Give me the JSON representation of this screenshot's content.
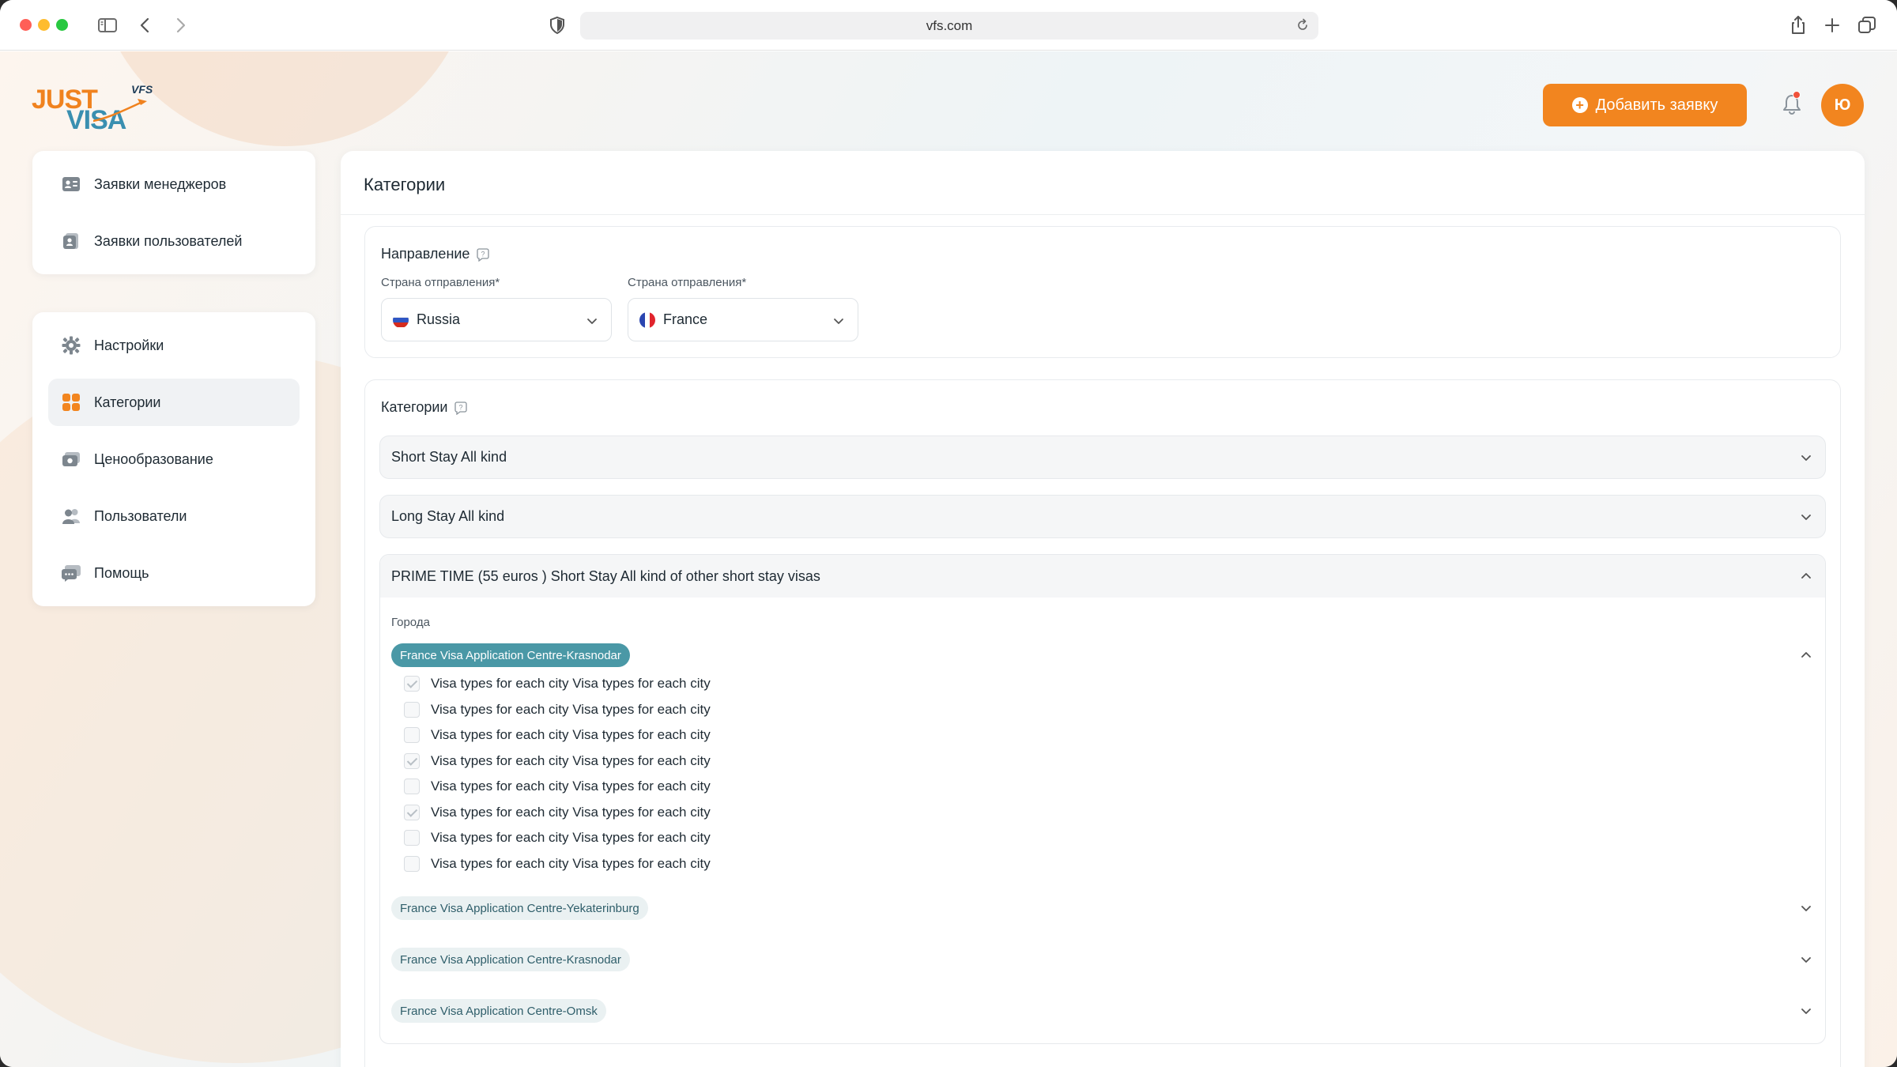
{
  "browser": {
    "url": "vfs.com"
  },
  "header": {
    "logo": {
      "just": "JUST",
      "visa": "VISA",
      "vfs": "VFS"
    },
    "add_button_label": "Добавить заявку",
    "avatar_initial": "Ю"
  },
  "sidebar": {
    "top_items": [
      {
        "label": "Заявки менеджеров",
        "icon": "id-card-icon"
      },
      {
        "label": "Заявки пользователей",
        "icon": "user-requests-icon"
      }
    ],
    "items": [
      {
        "label": "Настройки",
        "icon": "gear-icon",
        "active": false
      },
      {
        "label": "Категории",
        "icon": "grid-icon",
        "active": true
      },
      {
        "label": "Ценообразование",
        "icon": "money-icon",
        "active": false
      },
      {
        "label": "Пользователи",
        "icon": "users-icon",
        "active": false
      },
      {
        "label": "Помощь",
        "icon": "chat-icon",
        "active": false
      }
    ]
  },
  "main": {
    "title": "Категории",
    "direction": {
      "title": "Направление",
      "from_label": "Страна отправления*",
      "from_value": "Russia",
      "to_label": "Страна отправления*",
      "to_value": "France"
    },
    "categories": {
      "title": "Категории",
      "collapsed": [
        {
          "label": "Short Stay All kind"
        },
        {
          "label": "Long Stay All kind"
        }
      ],
      "open": {
        "label": "PRIME TIME (55 euros ) Short Stay All kind of other short stay visas",
        "cities_label": "Города",
        "active_city": "France Visa Application Centre-Krasnodar",
        "visa_types": [
          {
            "label": "Visa types for each city Visa types for each city",
            "checked": true
          },
          {
            "label": "Visa types for each city Visa types for each city",
            "checked": false
          },
          {
            "label": "Visa types for each city Visa types for each city",
            "checked": false
          },
          {
            "label": "Visa types for each city Visa types for each city",
            "checked": true
          },
          {
            "label": "Visa types for each city Visa types for each city",
            "checked": false
          },
          {
            "label": "Visa types for each city Visa types for each city",
            "checked": true
          },
          {
            "label": "Visa types for each city Visa types for each city",
            "checked": false
          },
          {
            "label": "Visa types for each city Visa types for each city",
            "checked": false
          }
        ],
        "other_cities": [
          "France Visa Application Centre-Yekaterinburg",
          "France Visa Application Centre-Krasnodar",
          "France Visa Application Centre-Omsk"
        ]
      }
    }
  },
  "colors": {
    "accent_orange": "#f2851f",
    "teal": "#4a98a6",
    "logo_blue": "#3a8fb0"
  }
}
